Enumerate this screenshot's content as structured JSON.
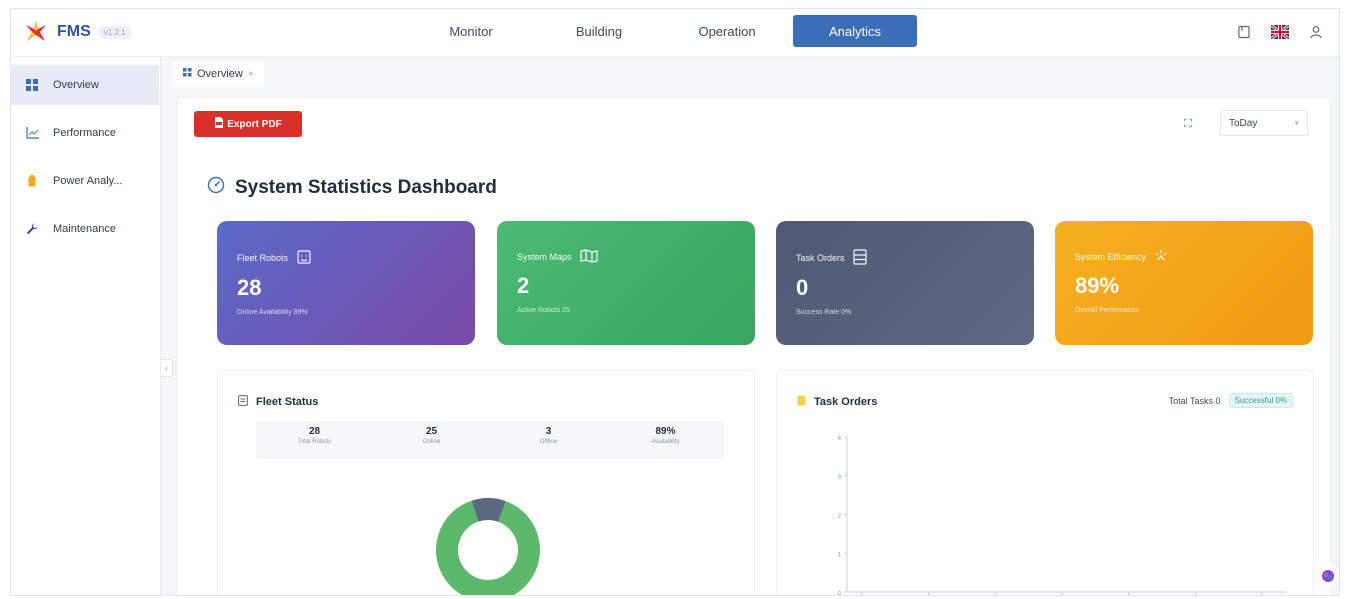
{
  "app": {
    "name": "FMS",
    "version": "v1.2.1"
  },
  "nav": {
    "items": [
      {
        "label": "Monitor"
      },
      {
        "label": "Building"
      },
      {
        "label": "Operation"
      },
      {
        "label": "Analytics"
      }
    ],
    "active": "Analytics"
  },
  "top_icons": [
    "book-icon",
    "uk-flag-icon",
    "user-icon"
  ],
  "sidebar": {
    "items": [
      {
        "label": "Overview",
        "icon": "grid-icon",
        "active": true
      },
      {
        "label": "Performance",
        "icon": "line-chart-icon",
        "active": false
      },
      {
        "label": "Power Analy...",
        "icon": "battery-icon",
        "active": false
      },
      {
        "label": "Maintenance",
        "icon": "wrench-icon",
        "active": false
      }
    ]
  },
  "tabs": [
    {
      "label": "Overview",
      "close": "×"
    }
  ],
  "toolbar": {
    "export_label": "Export PDF",
    "range_value": "ToDay"
  },
  "dashboard": {
    "title": "System Statistics Dashboard",
    "cards": [
      {
        "label": "Fleet Robots",
        "value": "28",
        "sub": "Online Availability 89%",
        "icon": "robot-icon",
        "color": "#6a5abb"
      },
      {
        "label": "System Maps",
        "value": "2",
        "sub": "Active Robots 25",
        "icon": "map-icon",
        "color": "#45b46c"
      },
      {
        "label": "Task Orders",
        "value": "0",
        "sub": "Success Rate 0%",
        "icon": "list-icon",
        "color": "#515e76"
      },
      {
        "label": "System Efficiency",
        "value": "89%",
        "sub": "Overall Performance",
        "icon": "speed-icon",
        "color": "#f3a819"
      }
    ]
  },
  "fleet_status": {
    "title": "Fleet Status",
    "stats": [
      {
        "value": "28",
        "label": "Total Robots"
      },
      {
        "value": "25",
        "label": "Online"
      },
      {
        "value": "3",
        "label": "Offline"
      },
      {
        "value": "89%",
        "label": "Availability"
      }
    ],
    "donut": {
      "segments": [
        {
          "name": "Online",
          "value": 25,
          "color": "#5cb86a"
        },
        {
          "name": "Offline",
          "value": 3,
          "color": "#5a6a7e"
        }
      ]
    }
  },
  "task_orders": {
    "title": "Task Orders",
    "total_label": "Total Tasks 0",
    "badge": "Successful 0%"
  },
  "chart_data": {
    "type": "line",
    "title": "",
    "y_ticks": [
      "0",
      "1",
      "2",
      "3",
      "4"
    ],
    "x_count": 7,
    "ylim": [
      0,
      4
    ],
    "series": []
  }
}
